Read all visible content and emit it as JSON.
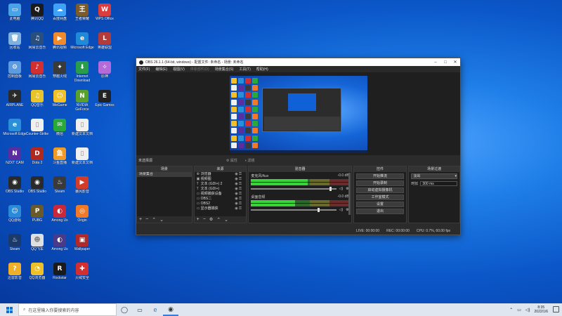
{
  "desktop": {
    "icons": [
      {
        "label": "此电脑",
        "col": 0,
        "row": 0,
        "color": "#4aa3e6",
        "glyph": "▭"
      },
      {
        "label": "腾讯QQ",
        "col": 1,
        "row": 0,
        "color": "#1b1b1b",
        "glyph": "Q"
      },
      {
        "label": "百度网盘",
        "col": 2,
        "row": 0,
        "color": "#3fa2f7",
        "glyph": "☁"
      },
      {
        "label": "王者荣耀",
        "col": 3,
        "row": 0,
        "color": "#7a5b2a",
        "glyph": "王"
      },
      {
        "label": "WPS Office",
        "col": 4,
        "row": 0,
        "color": "#d93d3d",
        "glyph": "W"
      },
      {
        "label": "回收站",
        "col": 0,
        "row": 1,
        "color": "#7fb0de",
        "glyph": "🗑"
      },
      {
        "label": "网易云音乐",
        "col": 1,
        "row": 1,
        "color": "#2b4f7d",
        "glyph": "♫"
      },
      {
        "label": "腾讯视频",
        "col": 2,
        "row": 1,
        "color": "#f08a2a",
        "glyph": "▶"
      },
      {
        "label": "Microsoft Edge",
        "col": 3,
        "row": 1,
        "color": "#1f8ad8",
        "glyph": "e"
      },
      {
        "label": "英雄联盟",
        "col": 4,
        "row": 1,
        "color": "#b53a3a",
        "glyph": "L"
      },
      {
        "label": "控制面板",
        "col": 0,
        "row": 2,
        "color": "#5d9be0",
        "glyph": "⚙"
      },
      {
        "label": "网易云音乐",
        "col": 1,
        "row": 2,
        "color": "#d23030",
        "glyph": "♪"
      },
      {
        "label": "穿越火线",
        "col": 2,
        "row": 2,
        "color": "#3a3a3a",
        "glyph": "✦"
      },
      {
        "label": "Internet Download",
        "col": 3,
        "row": 2,
        "color": "#2a9d4b",
        "glyph": "⬇"
      },
      {
        "label": "原神",
        "col": 4,
        "row": 2,
        "color": "#b46ad8",
        "glyph": "✧"
      },
      {
        "label": "AIRPLANE",
        "col": 0,
        "row": 3,
        "color": "#2a2a2a",
        "glyph": "✈"
      },
      {
        "label": "QQ音乐",
        "col": 1,
        "row": 3,
        "color": "#e8c42a",
        "glyph": "♫"
      },
      {
        "label": "WeGame",
        "col": 2,
        "row": 3,
        "color": "#f4c028",
        "glyph": "☺"
      },
      {
        "label": "NVIDIA GeForce",
        "col": 3,
        "row": 3,
        "color": "#5aa02c",
        "glyph": "N"
      },
      {
        "label": "Epic Games",
        "col": 4,
        "row": 3,
        "color": "#222",
        "glyph": "E"
      },
      {
        "label": "Microsoft Edge",
        "col": 0,
        "row": 4,
        "color": "#2a8fd8",
        "glyph": "e"
      },
      {
        "label": "Counter-Strike",
        "col": 1,
        "row": 4,
        "color": "#f0f0f0",
        "glyph": "▯"
      },
      {
        "label": "微信",
        "col": 2,
        "row": 4,
        "color": "#2aa83a",
        "glyph": "✉"
      },
      {
        "label": "新建文本文档",
        "col": 3,
        "row": 4,
        "color": "#f0f0f0",
        "glyph": "▯"
      },
      {
        "label": "NZXT CAM",
        "col": 0,
        "row": 5,
        "color": "#5a2ea0",
        "glyph": "N"
      },
      {
        "label": "Dota 2",
        "col": 1,
        "row": 5,
        "color": "#b0281e",
        "glyph": "D"
      },
      {
        "label": "斗鱼直播",
        "col": 2,
        "row": 5,
        "color": "#f09a2a",
        "glyph": "鱼"
      },
      {
        "label": "新建文本文档",
        "col": 3,
        "row": 5,
        "color": "#f0f0f0",
        "glyph": "▯"
      },
      {
        "label": "OBS Studio",
        "col": 0,
        "row": 6,
        "color": "#2a2a2a",
        "glyph": "◉"
      },
      {
        "label": "OBS Studio",
        "col": 1,
        "row": 6,
        "color": "#2a2a2a",
        "glyph": "◉"
      },
      {
        "label": "Steam",
        "col": 2,
        "row": 6,
        "color": "#3a3a3a",
        "glyph": "♨"
      },
      {
        "label": "暴风影音",
        "col": 3,
        "row": 6,
        "color": "#d23c2a",
        "glyph": "▶"
      },
      {
        "label": "QQ游戏",
        "col": 0,
        "row": 7,
        "color": "#2a8ad8",
        "glyph": "☺"
      },
      {
        "label": "PUBG",
        "col": 1,
        "row": 7,
        "color": "#6a5a2a",
        "glyph": "P"
      },
      {
        "label": "Among Us",
        "col": 2,
        "row": 7,
        "color": "#c8283a",
        "glyph": "◐"
      },
      {
        "label": "Origin",
        "col": 3,
        "row": 7,
        "color": "#f07a2a",
        "glyph": "◎"
      },
      {
        "label": "Steam",
        "col": 0,
        "row": 8,
        "color": "#1b3a6a",
        "glyph": "♨"
      },
      {
        "label": "QQ飞车",
        "col": 1,
        "row": 8,
        "color": "#e0e0e0",
        "glyph": "☻"
      },
      {
        "label": "Among Us",
        "col": 2,
        "row": 8,
        "color": "#4b3a8a",
        "glyph": "◐"
      },
      {
        "label": "Wallpaper",
        "col": 3,
        "row": 8,
        "color": "#b02a2a",
        "glyph": "▣"
      },
      {
        "label": "迅雷影音",
        "col": 0,
        "row": 9,
        "color": "#f0b02a",
        "glyph": "?"
      },
      {
        "label": "QQ浏览器",
        "col": 1,
        "row": 9,
        "color": "#f0c02a",
        "glyph": "◔"
      },
      {
        "label": "Rockstar",
        "col": 2,
        "row": 9,
        "color": "#1a1a1a",
        "glyph": "R"
      },
      {
        "label": "火绒安全",
        "col": 3,
        "row": 9,
        "color": "#d23030",
        "glyph": "✚"
      }
    ]
  },
  "obs": {
    "title": "OBS 26.1.1 (64-bit, windows) - 配置文件: 未命名 - 场景: 未命名",
    "menu": [
      "文件(F)",
      "编辑(E)",
      "视图(V)",
      "停靠部件(D)",
      "场景集合(S)",
      "工具(T)",
      "帮助(H)"
    ],
    "menu_disabled_index": 3,
    "no_source": "未选择源",
    "props_label": "属性",
    "filters_label": "滤镜",
    "scenes_header": "场景",
    "scenes": [
      "场景集合"
    ],
    "sources_header": "来源",
    "sources": [
      {
        "icon": "⊕",
        "name": "浏览器"
      },
      {
        "icon": "▣",
        "name": "视频图"
      },
      {
        "icon": "T",
        "name": "文本 (GDI+) 2"
      },
      {
        "icon": "T",
        "name": "文本 (GDI+)"
      },
      {
        "icon": "▭",
        "name": "视频捕获设备"
      },
      {
        "icon": "▭",
        "name": "OBS二"
      },
      {
        "icon": "▭",
        "name": "OBS2"
      },
      {
        "icon": "▭",
        "name": "显示器捕获"
      }
    ],
    "mixer_header": "混音器",
    "mixer": [
      {
        "name": "麦克风/Aux",
        "db": "-0.0 dB",
        "level": 0.58,
        "volume": 0.92
      },
      {
        "name": "桌面音频",
        "db": "-0.0 dB",
        "level": 0.45,
        "volume": 0.78
      }
    ],
    "controls_header": "控件",
    "controls": [
      "开始推流",
      "开始录制",
      "启动虚拟摄像机",
      "工作室模式",
      "设置",
      "退出"
    ],
    "transitions_header": "场景过渡",
    "transition_name": "淡出",
    "duration_label": "时长",
    "duration_value": "300 ms",
    "status": {
      "live": "LIVE: 00:00:00",
      "rec": "REC: 00:00:00",
      "cpu": "CPU: 0.7%, 60.00 fps"
    }
  },
  "taskbar": {
    "search_placeholder": "在这里输入你要搜索的内容",
    "time": "8:35",
    "date": "2022/1/6"
  }
}
